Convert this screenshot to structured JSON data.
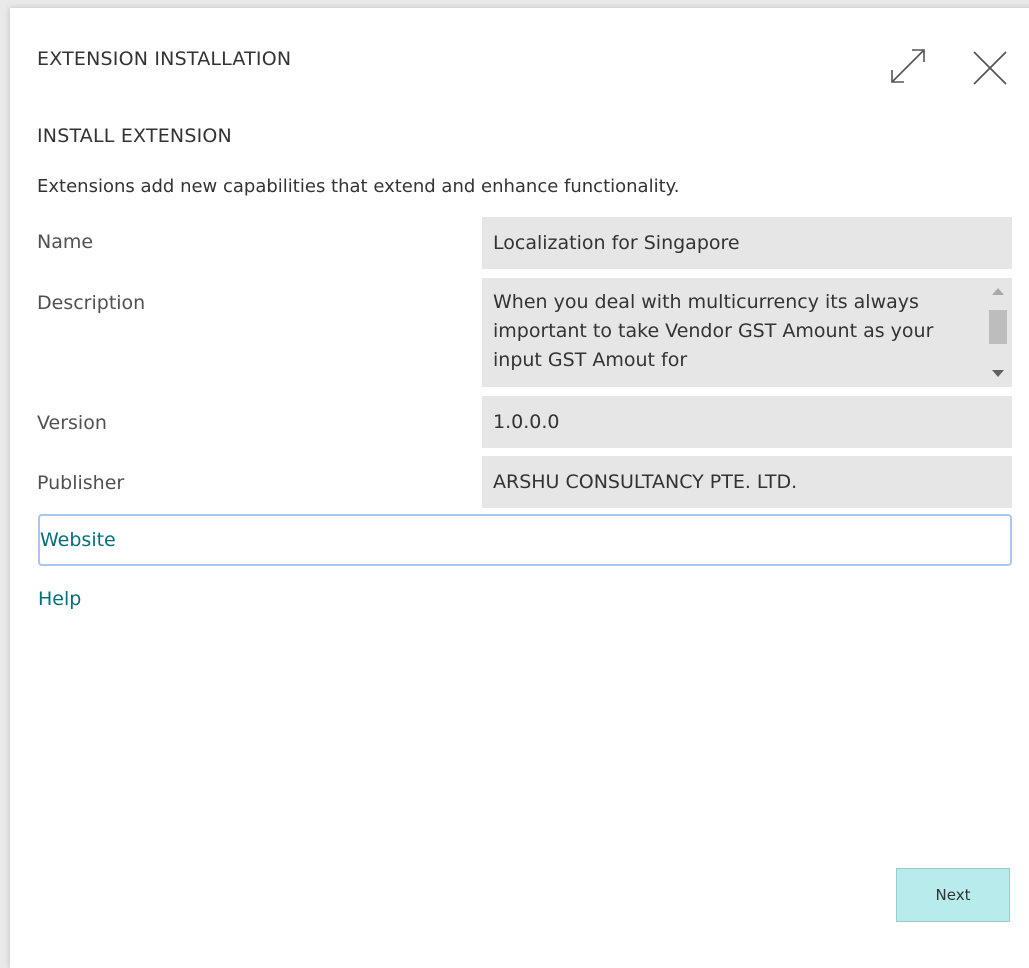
{
  "dialog": {
    "title": "EXTENSION INSTALLATION",
    "subtitle": "INSTALL EXTENSION",
    "intro": "Extensions add new capabilities that extend and enhance functionality.",
    "icons": {
      "expand": "expand-icon",
      "close": "close-icon"
    }
  },
  "fields": {
    "name": {
      "label": "Name",
      "value": "Localization for Singapore"
    },
    "description": {
      "label": "Description",
      "value": "When you deal with multicurrency its always important to take Vendor GST Amount as your input GST Amout for"
    },
    "version": {
      "label": "Version",
      "value": "1.0.0.0"
    },
    "publisher": {
      "label": "Publisher",
      "value": "ARSHU CONSULTANCY PTE. LTD."
    }
  },
  "links": {
    "website": "Website",
    "help": "Help"
  },
  "actions": {
    "next": "Next"
  },
  "colors": {
    "link": "#00707a",
    "field_bg": "#e6e6e6",
    "next_bg": "#b8ecec",
    "focus_border": "#a8c6f0"
  }
}
